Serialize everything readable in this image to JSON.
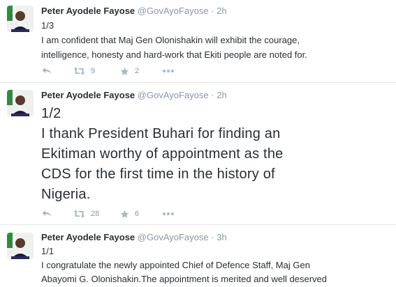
{
  "tweets": [
    {
      "fullname": "Peter Ayodele Fayose",
      "screen_name": "@GovAyoFayose",
      "separator": "·",
      "time": "2h",
      "text": "1/3\nI am confident that Maj Gen Olonishakin will exhibit the courage,\nintelligence, honesty and hard-work that Ekiti people are noted for.",
      "retweets": "9",
      "favorites": "2"
    },
    {
      "fullname": "Peter Ayodele Fayose",
      "screen_name": "@GovAyoFayose",
      "separator": "·",
      "time": "2h",
      "text": "1/2\nI thank President Buhari for finding an\nEkitiman worthy of appointment as the\nCDS for the first time in the history of\nNigeria.",
      "retweets": "28",
      "favorites": "6"
    },
    {
      "fullname": "Peter Ayodele Fayose",
      "screen_name": "@GovAyoFayose",
      "separator": "·",
      "time": "3h",
      "text": "1/1\nI congratulate the newly appointed Chief of Defence Staff, Maj Gen\nAbayomi G. Olonishakin.The appointment is merited and well deserved"
    }
  ],
  "icons": {
    "reply": "reply-icon",
    "retweet": "retweet-icon",
    "favorite": "star-icon",
    "more": "more-icon"
  },
  "colors": {
    "action_icon": "#aab8c2",
    "meta_text": "#8899a6",
    "body_text": "#292f33",
    "divider": "#e1e8ed"
  }
}
